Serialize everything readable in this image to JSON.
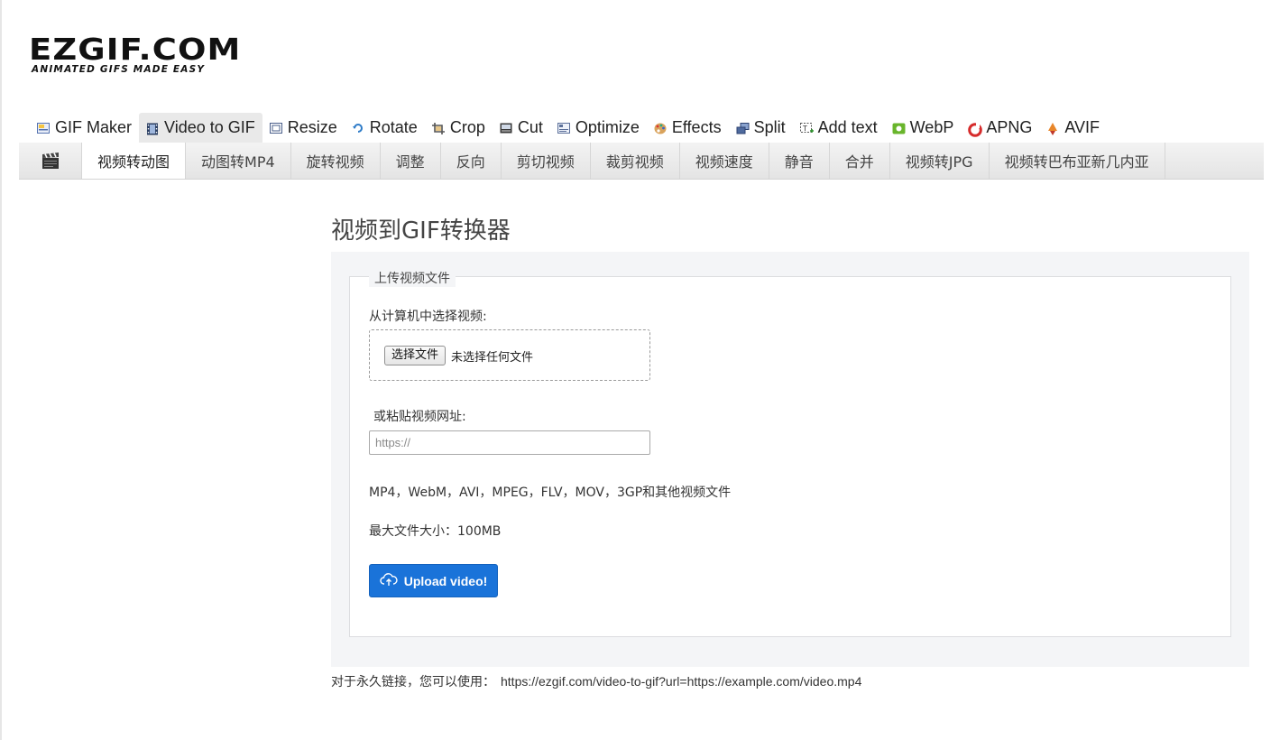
{
  "logo": {
    "main": "EZGIF.COM",
    "tagline": "ANIMATED GIFS MADE EASY"
  },
  "main_nav": {
    "items": [
      {
        "label": "GIF Maker",
        "icon": "gif-maker-icon"
      },
      {
        "label": "Video to GIF",
        "icon": "film-icon",
        "active": true
      },
      {
        "label": "Resize",
        "icon": "resize-icon"
      },
      {
        "label": "Rotate",
        "icon": "rotate-icon"
      },
      {
        "label": "Crop",
        "icon": "crop-icon"
      },
      {
        "label": "Cut",
        "icon": "cut-icon"
      },
      {
        "label": "Optimize",
        "icon": "optimize-icon"
      },
      {
        "label": "Effects",
        "icon": "palette-icon"
      },
      {
        "label": "Split",
        "icon": "split-icon"
      },
      {
        "label": "Add text",
        "icon": "add-text-icon"
      },
      {
        "label": "WebP",
        "icon": "webp-icon"
      },
      {
        "label": "APNG",
        "icon": "apng-icon"
      },
      {
        "label": "AVIF",
        "icon": "avif-icon"
      }
    ]
  },
  "sub_nav": {
    "icon": "clapperboard-icon",
    "items": [
      {
        "label": "视频转动图",
        "active": true
      },
      {
        "label": "动图转MP4"
      },
      {
        "label": "旋转视频"
      },
      {
        "label": "调整"
      },
      {
        "label": "反向"
      },
      {
        "label": "剪切视频"
      },
      {
        "label": "裁剪视频"
      },
      {
        "label": "视频速度"
      },
      {
        "label": "静音"
      },
      {
        "label": "合并"
      },
      {
        "label": "视频转JPG"
      },
      {
        "label": "视频转巴布亚新几内亚"
      }
    ]
  },
  "page": {
    "title": "视频到GIF转换器",
    "legend": "上传视频文件",
    "choose_label": "从计算机中选择视频:",
    "file_button": "选择文件",
    "file_status": "未选择任何文件",
    "url_label": "或粘贴视频网址:",
    "url_placeholder": "https://",
    "formats": "MP4，WebM，AVI，MPEG，FLV，MOV，3GP和其他视频文件",
    "max_size": "最大文件大小：100MB",
    "upload_button": "Upload video!",
    "upload_icon": "cloud-upload-icon"
  },
  "footer": {
    "note": "对于永久链接，您可以使用：",
    "url": "https://ezgif.com/video-to-gif?url=https://example.com/video.mp4"
  },
  "colors": {
    "primary_button": "#1a73d9",
    "panel_bg": "#f4f5f7",
    "subnav_bg": "#e9e9e9"
  }
}
